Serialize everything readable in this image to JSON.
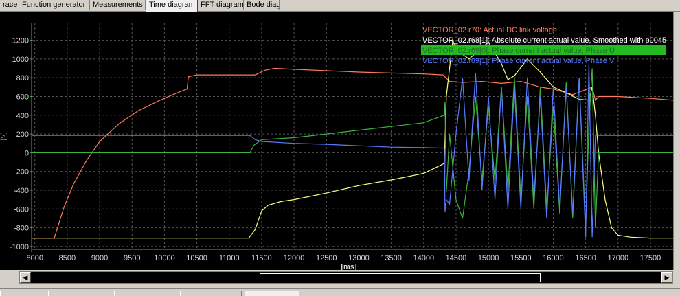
{
  "tabs": [
    {
      "label": "race"
    },
    {
      "label": "Function generator"
    },
    {
      "label": "Measurements"
    },
    {
      "label": "Time diagram"
    },
    {
      "label": "FFT diagram"
    },
    {
      "label": "Bode diagram"
    }
  ],
  "active_tab": "Time diagram",
  "colors": {
    "red": "#ff7a5c",
    "yellow": "#ffff80",
    "green": "#3cb43c",
    "blue": "#5a7aff",
    "grid": "#5a5a5a",
    "axis_text": "#d8d8d8"
  },
  "chart_data": {
    "type": "line",
    "xlabel": "[ms]",
    "ylabel": "[V]",
    "xlim": [
      7950,
      17850
    ],
    "ylim": [
      -1030,
      1380
    ],
    "x_ticks": [
      8000,
      8500,
      9000,
      9500,
      10000,
      10500,
      11000,
      11500,
      12000,
      12500,
      13000,
      13500,
      14000,
      14500,
      15000,
      15500,
      16000,
      16500,
      17000,
      17500
    ],
    "y_ticks": [
      1200,
      1000,
      800,
      600,
      400,
      200,
      0,
      -200,
      -400,
      -600,
      -800,
      -1000
    ],
    "legend": [
      {
        "name": "VECTOR_02.r70: Actual DC link voltage",
        "color": "#ff7a5c",
        "highlight": false
      },
      {
        "name": "VECTOR_02.r68[1]: Absolute current actual value, Smoothed with p0045",
        "color": "#ffffff",
        "highlight": false
      },
      {
        "name": "VECTOR_02.r69[0]: Phase current actual value, Phase U",
        "color": "#1e6e1e",
        "highlight": true
      },
      {
        "name": "VECTOR_02.r69[1]: Phase current actual value, Phase V",
        "color": "#5a7aff",
        "highlight": false
      }
    ],
    "series": [
      {
        "name": "VECTOR_02.r70: Actual DC link voltage",
        "color": "#ff7a5c",
        "x": [
          7950,
          8300,
          8450,
          8600,
          8800,
          9000,
          9300,
          9600,
          9900,
          10200,
          10350,
          10370,
          10500,
          11000,
          11400,
          11550,
          11700,
          12000,
          13000,
          14000,
          14300,
          14400,
          14600,
          14900,
          15200,
          15500,
          15800,
          16000,
          16300,
          16600,
          16650,
          16700,
          17000,
          17500,
          17850
        ],
        "y": [
          -910,
          -910,
          -580,
          -330,
          -80,
          120,
          310,
          450,
          550,
          640,
          680,
          810,
          830,
          830,
          830,
          880,
          900,
          890,
          860,
          840,
          830,
          760,
          750,
          760,
          740,
          760,
          700,
          680,
          620,
          700,
          560,
          600,
          600,
          580,
          560
        ]
      },
      {
        "name": "VECTOR_02.r68[1]: Absolute current actual value, Smoothed with p0045",
        "color": "#ffff80",
        "x": [
          7950,
          11300,
          11400,
          11500,
          11600,
          11800,
          12000,
          12500,
          13000,
          13500,
          14000,
          14300,
          14320,
          14350,
          14400,
          14450,
          14500,
          14700,
          15000,
          15200,
          15300,
          15400,
          15600,
          15800,
          16000,
          16200,
          16400,
          16550,
          16600,
          16650,
          16700,
          16800,
          16900,
          17000,
          17200,
          17500,
          17850
        ],
        "y": [
          -910,
          -910,
          -820,
          -620,
          -560,
          -520,
          -500,
          -430,
          -350,
          -290,
          -220,
          -120,
          -100,
          600,
          900,
          1200,
          1100,
          1000,
          1180,
          950,
          780,
          820,
          1000,
          860,
          700,
          640,
          570,
          560,
          700,
          400,
          0,
          -500,
          -800,
          -880,
          -900,
          -910,
          -910
        ]
      },
      {
        "name": "VECTOR_02.r69[0]: Phase current actual value, Phase U",
        "color": "#3cb43c",
        "x": [
          7950,
          11320,
          11380,
          11500,
          12000,
          12500,
          13000,
          13500,
          14000,
          14320,
          14330,
          14350,
          14400,
          14500,
          14600,
          14700,
          14800,
          14900,
          15000,
          15100,
          15200,
          15300,
          15400,
          15500,
          15600,
          15700,
          15800,
          15900,
          16000,
          16100,
          16200,
          16300,
          16400,
          16500,
          16550,
          16600,
          16650,
          16700,
          16800,
          17000,
          17500,
          17850
        ],
        "y": [
          0,
          0,
          80,
          140,
          160,
          200,
          240,
          280,
          320,
          400,
          540,
          -420,
          200,
          -500,
          -700,
          -200,
          600,
          -300,
          500,
          -300,
          700,
          -400,
          800,
          -500,
          600,
          -600,
          700,
          -600,
          500,
          -650,
          750,
          -700,
          800,
          -800,
          300,
          900,
          -800,
          0,
          0,
          0,
          0,
          0
        ]
      },
      {
        "name": "VECTOR_02.r69[1]: Phase current actual value, Phase V",
        "color": "#5a7aff",
        "x": [
          7950,
          11320,
          11400,
          11500,
          12000,
          12500,
          13000,
          13500,
          14000,
          14320,
          14330,
          14350,
          14400,
          14500,
          14600,
          14700,
          14800,
          14900,
          15000,
          15100,
          15200,
          15300,
          15400,
          15500,
          15600,
          15700,
          15800,
          15900,
          16000,
          16100,
          16200,
          16300,
          16400,
          16500,
          16550,
          16600,
          16650,
          16700,
          16800,
          17000,
          17500,
          17850
        ],
        "y": [
          185,
          185,
          140,
          120,
          100,
          90,
          75,
          60,
          55,
          50,
          -630,
          -500,
          -550,
          200,
          800,
          -300,
          850,
          -400,
          600,
          -500,
          700,
          -600,
          700,
          -600,
          800,
          -500,
          600,
          -700,
          700,
          -600,
          700,
          -650,
          800,
          -900,
          950,
          -900,
          185,
          185,
          185,
          185,
          185,
          185
        ]
      }
    ]
  }
}
